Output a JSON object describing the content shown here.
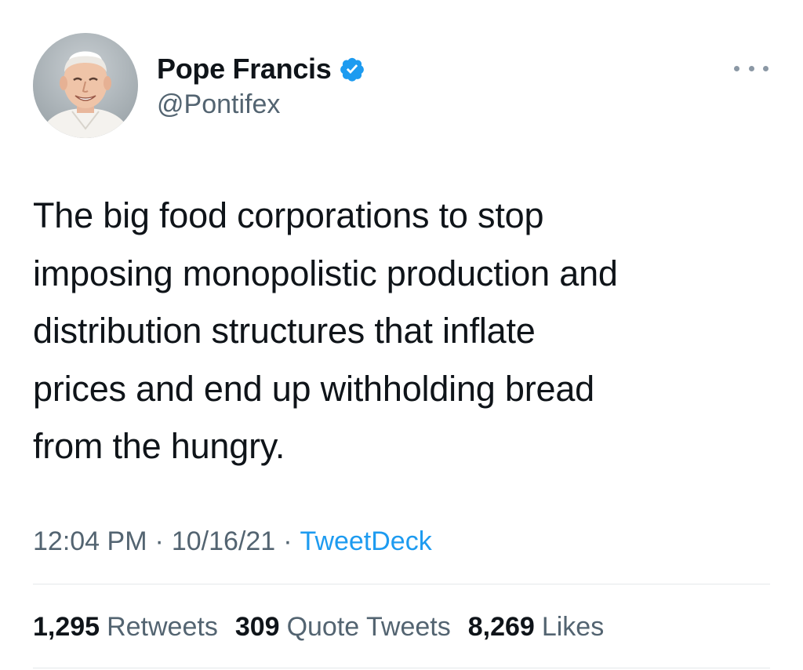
{
  "author": {
    "name": "Pope Francis",
    "handle": "@Pontifex",
    "verified": true,
    "avatar_icon": "pope-portrait-avatar"
  },
  "tweet": {
    "text": "The big food corporations to stop\nimposing monopolistic production and\ndistribution structures that inflate\nprices and end up withholding bread\nfrom the hungry."
  },
  "meta": {
    "time": "12:04 PM",
    "separator": "·",
    "date": "10/16/21",
    "source": "TweetDeck"
  },
  "stats": {
    "retweets": {
      "count": "1,295",
      "label": "Retweets"
    },
    "quote_tweets": {
      "count": "309",
      "label": "Quote Tweets"
    },
    "likes": {
      "count": "8,269",
      "label": "Likes"
    }
  },
  "colors": {
    "text": "#0f1419",
    "secondary": "#536471",
    "link": "#1d9bf0",
    "verified": "#1d9bf0",
    "divider": "#e4e8eb"
  },
  "icons": {
    "verified": "verified-badge-icon",
    "more": "more-options-icon"
  }
}
